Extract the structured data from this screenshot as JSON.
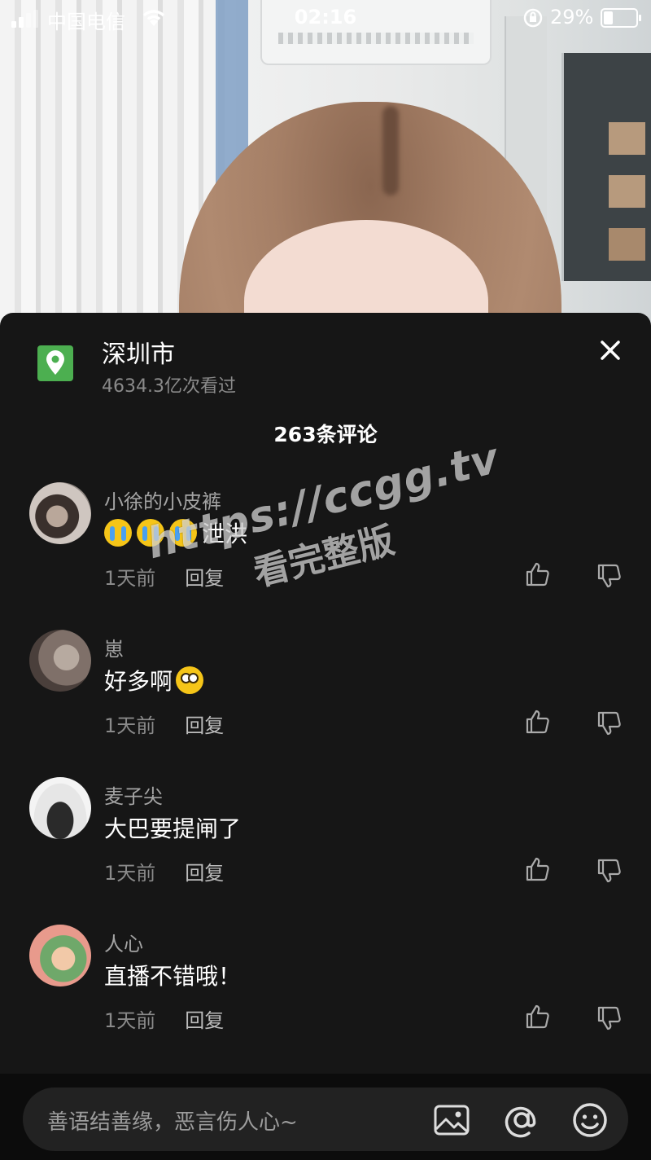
{
  "status_bar": {
    "carrier": "中国电信",
    "time": "02:16",
    "battery_percent": "29%",
    "battery_level": 0.29,
    "signal_bars": 2
  },
  "location": {
    "title": "深圳市",
    "views": "4634.3亿次看过",
    "icon": "map-pin-icon",
    "icon_color": "#4caf50"
  },
  "comment_count": "263条评论",
  "comments": [
    {
      "username": "小徐的小皮裤",
      "text": "泄洪",
      "emoji": [
        "loudly-crying-face",
        "loudly-crying-face",
        "loudly-crying-face"
      ],
      "time": "1天前",
      "reply": "回复"
    },
    {
      "username": "崽",
      "text": "好多啊",
      "emoji": [
        "pleading-face"
      ],
      "time": "1天前",
      "reply": "回复"
    },
    {
      "username": "麦子尖",
      "text": "大巴要提闸了",
      "emoji": [],
      "time": "1天前",
      "reply": "回复"
    },
    {
      "username": "人心",
      "text": "直播不错哦！",
      "emoji": [],
      "time": "1天前",
      "reply": "回复"
    }
  ],
  "watermark": {
    "url": "https://ccgg.tv",
    "subtitle": "看完整版"
  },
  "input": {
    "placeholder": "善语结善缘，恶言伤人心~"
  },
  "colors": {
    "sheet_bg": "#161616",
    "text_primary": "#ffffff",
    "text_secondary": "#8a8a8a"
  }
}
